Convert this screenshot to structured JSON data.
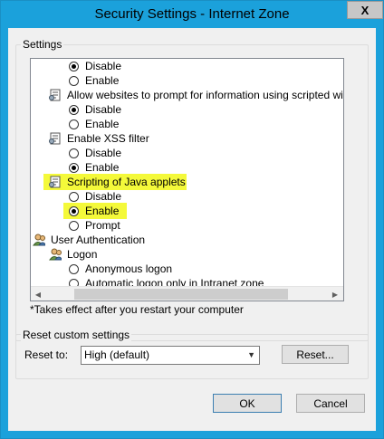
{
  "window": {
    "title": "Security Settings - Internet Zone",
    "close_glyph": "X"
  },
  "settings_group": {
    "label": "Settings",
    "rows": [
      {
        "text": "Disable",
        "kind": "radio",
        "checked": true
      },
      {
        "text": "Enable",
        "kind": "radio",
        "checked": false
      },
      {
        "text": "Allow websites to prompt for information using scripted windo",
        "kind": "setting"
      },
      {
        "text": "Disable",
        "kind": "radio",
        "checked": true
      },
      {
        "text": "Enable",
        "kind": "radio",
        "checked": false
      },
      {
        "text": "Enable XSS filter",
        "kind": "setting"
      },
      {
        "text": "Disable",
        "kind": "radio",
        "checked": false
      },
      {
        "text": "Enable",
        "kind": "radio",
        "checked": true
      },
      {
        "text": "Scripting of Java applets",
        "kind": "setting"
      },
      {
        "text": "Disable",
        "kind": "radio",
        "checked": false
      },
      {
        "text": "Enable",
        "kind": "radio",
        "checked": true
      },
      {
        "text": "Prompt",
        "kind": "radio",
        "checked": false
      },
      {
        "text": "User Authentication",
        "kind": "users"
      },
      {
        "text": "Logon",
        "kind": "users"
      },
      {
        "text": "Anonymous logon",
        "kind": "radio",
        "checked": false
      },
      {
        "text": "Automatic logon only in Intranet zone",
        "kind": "radio",
        "checked": false
      }
    ],
    "note": "*Takes effect after you restart your computer"
  },
  "reset_group": {
    "label": "Reset custom settings",
    "reset_to_label": "Reset to:",
    "selected": "High (default)",
    "reset_button": "Reset..."
  },
  "footer": {
    "ok": "OK",
    "cancel": "Cancel"
  },
  "colors": {
    "highlight": "#f4f93a",
    "window_frame": "#1ba1db"
  }
}
